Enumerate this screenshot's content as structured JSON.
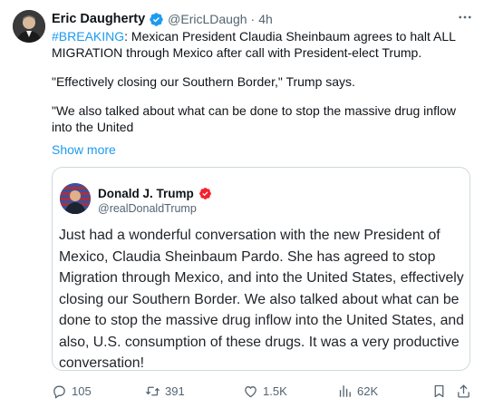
{
  "author": {
    "name": "Eric Daugherty",
    "handle": "@EricLDaugh",
    "separator": "·",
    "time": "4h"
  },
  "tweet": {
    "hashtag": "#BREAKING",
    "line1_rest": ": Mexican President Claudia Sheinbaum agrees to halt ALL MIGRATION through Mexico after call with President-elect Trump.",
    "para2": "\"Effectively closing our Southern Border,\" Trump says.",
    "para3": "\"We also talked about what can be done to stop the massive drug inflow into the United",
    "show_more": "Show more"
  },
  "quote": {
    "name": "Donald J. Trump",
    "handle": "@realDonaldTrump",
    "text": "Just had a wonderful conversation with the new President of Mexico, Claudia Sheinbaum Pardo. She has agreed to stop Migration through Mexico, and into the United States, effectively closing our Southern Border. We also talked about what can be done to stop the massive drug inflow into the United States, and also, U.S. consumption of these drugs. It was a very productive conversation!"
  },
  "actions": {
    "replies": "105",
    "reposts": "391",
    "likes": "1.5K",
    "views": "62K"
  },
  "colors": {
    "accent": "#1d9bf0",
    "muted": "#536471",
    "border": "#cfd9de",
    "badge_red": "#f4212e"
  },
  "icons": [
    "verified-badge-icon",
    "more-icon",
    "reply-icon",
    "repost-icon",
    "like-icon",
    "views-icon",
    "bookmark-icon",
    "share-icon"
  ]
}
